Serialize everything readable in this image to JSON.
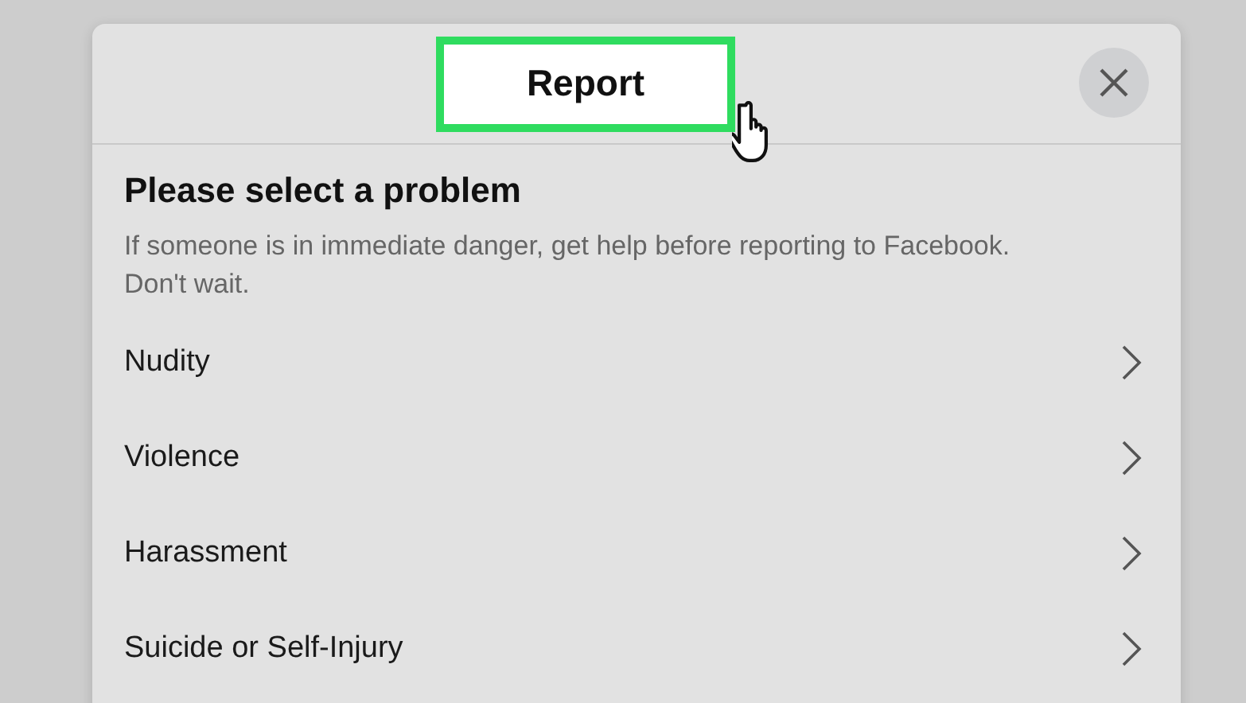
{
  "dialog": {
    "title": {
      "text": "Report",
      "highlighted": true
    },
    "heading": "Please select a problem",
    "subtitle": "If someone is in immediate danger, get help before reporting to Facebook. Don't wait.",
    "options": [
      {
        "label": "Nudity"
      },
      {
        "label": "Violence"
      },
      {
        "label": "Harassment"
      },
      {
        "label": "Suicide or Self-Injury"
      }
    ]
  }
}
